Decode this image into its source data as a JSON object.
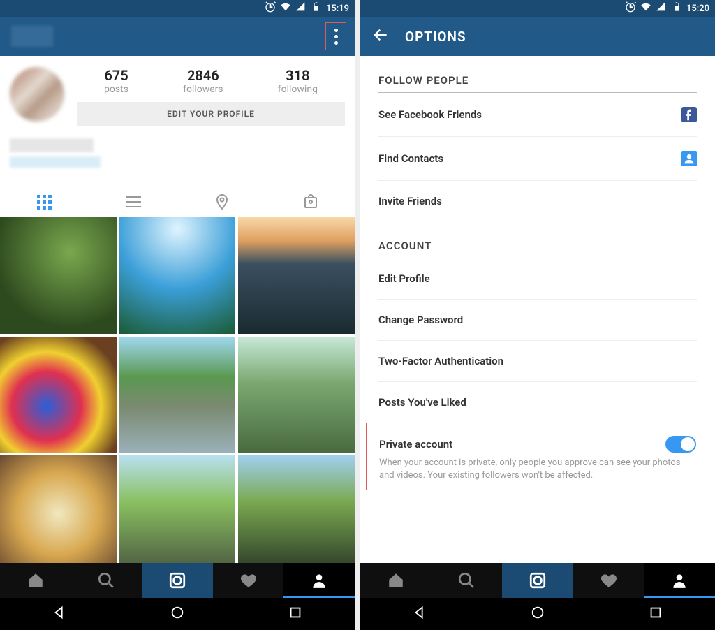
{
  "left": {
    "status_time": "15:19",
    "stats": {
      "posts_num": "675",
      "posts_label": "posts",
      "followers_num": "2846",
      "followers_label": "followers",
      "following_num": "318",
      "following_label": "following"
    },
    "edit_profile": "EDIT YOUR PROFILE"
  },
  "right": {
    "status_time": "15:20",
    "header": "OPTIONS",
    "section_follow": "FOLLOW PEOPLE",
    "follow_items": {
      "facebook": "See Facebook Friends",
      "contacts": "Find Contacts",
      "invite": "Invite Friends"
    },
    "section_account": "ACCOUNT",
    "account_items": {
      "edit_profile": "Edit Profile",
      "change_password": "Change Password",
      "two_factor": "Two-Factor Authentication",
      "posts_liked": "Posts You've Liked",
      "private": "Private account",
      "private_desc": "When your account is private, only people you approve can see your photos and videos. Your existing followers won't be affected."
    }
  }
}
